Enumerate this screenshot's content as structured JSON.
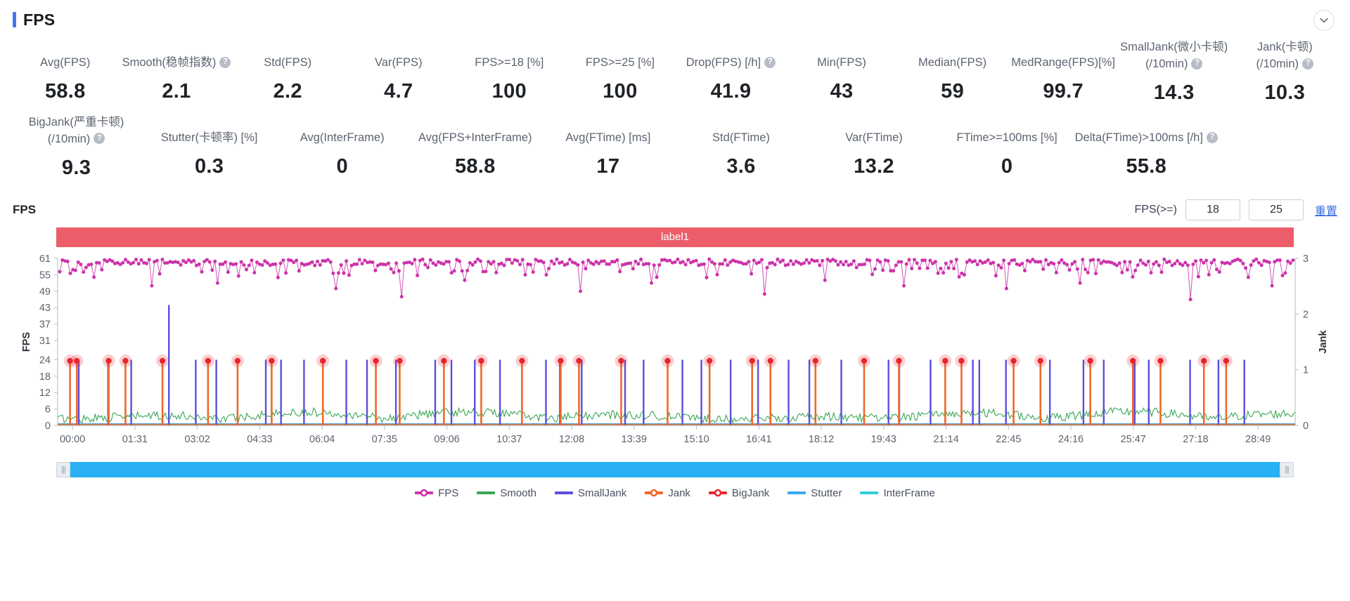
{
  "header": {
    "title": "FPS",
    "accent_color": "#4277f0",
    "collapse_icon": "chevron-down-icon"
  },
  "metrics_row1": [
    {
      "label_lines": [
        "Avg(FPS)"
      ],
      "help": false,
      "value": "58.8"
    },
    {
      "label_lines": [
        "Smooth(稳帧指数)"
      ],
      "help": true,
      "value": "2.1"
    },
    {
      "label_lines": [
        "Std(FPS)"
      ],
      "help": false,
      "value": "2.2"
    },
    {
      "label_lines": [
        "Var(FPS)"
      ],
      "help": false,
      "value": "4.7"
    },
    {
      "label_lines": [
        "FPS>=18 [%]"
      ],
      "help": false,
      "value": "100"
    },
    {
      "label_lines": [
        "FPS>=25 [%]"
      ],
      "help": false,
      "value": "100"
    },
    {
      "label_lines": [
        "Drop(FPS) [/h]"
      ],
      "help": true,
      "value": "41.9"
    },
    {
      "label_lines": [
        "Min(FPS)"
      ],
      "help": false,
      "value": "43"
    },
    {
      "label_lines": [
        "Median(FPS)"
      ],
      "help": false,
      "value": "59"
    },
    {
      "label_lines": [
        "MedRange(FPS)[%]"
      ],
      "help": false,
      "value": "99.7"
    },
    {
      "label_lines": [
        "SmallJank(微小卡顿)",
        "(/10min)"
      ],
      "help": true,
      "value": "14.3"
    },
    {
      "label_lines": [
        "Jank(卡顿)",
        "(/10min)"
      ],
      "help": true,
      "value": "10.3"
    }
  ],
  "metrics_row2": [
    {
      "label_lines": [
        "BigJank(严重卡顿)",
        "(/10min)"
      ],
      "help": true,
      "value": "9.3"
    },
    {
      "label_lines": [
        "Stutter(卡顿率) [%]"
      ],
      "help": false,
      "value": "0.3"
    },
    {
      "label_lines": [
        "Avg(InterFrame)"
      ],
      "help": false,
      "value": "0"
    },
    {
      "label_lines": [
        "Avg(FPS+InterFrame)"
      ],
      "help": false,
      "value": "58.8"
    },
    {
      "label_lines": [
        "Avg(FTime) [ms]"
      ],
      "help": false,
      "value": "17"
    },
    {
      "label_lines": [
        "Std(FTime)"
      ],
      "help": false,
      "value": "3.6"
    },
    {
      "label_lines": [
        "Var(FTime)"
      ],
      "help": false,
      "value": "13.2"
    },
    {
      "label_lines": [
        "FTime>=100ms [%]"
      ],
      "help": false,
      "value": "0"
    },
    {
      "label_lines": [
        "Delta(FTime)>100ms [/h]"
      ],
      "help": true,
      "value": "55.8"
    }
  ],
  "chart_header": {
    "title": "FPS",
    "threshold_label": "FPS(>=)",
    "threshold_1": "18",
    "threshold_2": "25",
    "reset_label": "重置"
  },
  "label_band": {
    "text": "label1",
    "color": "#ec5d6a"
  },
  "range_bar": {
    "left_handle": "|||",
    "right_handle": "|||",
    "color": "#29b0f4"
  },
  "chart_data": {
    "type": "line",
    "title": "FPS",
    "xlabel": "",
    "ylabel": "FPS",
    "y2label": "Jank",
    "grid": false,
    "legend_position": "bottom",
    "x_ticks": [
      "00:00",
      "01:31",
      "03:02",
      "04:33",
      "06:04",
      "07:35",
      "09:06",
      "10:37",
      "12:08",
      "13:39",
      "15:10",
      "16:41",
      "18:12",
      "19:43",
      "21:14",
      "22:45",
      "24:16",
      "25:47",
      "27:18",
      "28:49"
    ],
    "y_ticks": [
      0,
      6,
      12,
      18,
      24,
      31,
      37,
      43,
      49,
      55,
      61
    ],
    "ylim": [
      0,
      61
    ],
    "y2_ticks": [
      0,
      1,
      2,
      3
    ],
    "y2lim": [
      0,
      3
    ],
    "series": [
      {
        "name": "FPS",
        "color": "#cc33aa",
        "axis": "left",
        "style": "line-markers",
        "typical_value": 59,
        "min_value": 43,
        "dips": [
          56,
          51,
          52,
          54,
          50,
          47,
          53,
          55,
          49,
          52,
          54,
          48,
          53,
          51,
          55,
          50,
          52,
          54,
          46,
          51
        ]
      },
      {
        "name": "Smooth",
        "color": "#3aa655",
        "axis": "left",
        "style": "line",
        "typical_value": 3,
        "max_value": 8
      },
      {
        "name": "SmallJank",
        "color": "#5b4ee0",
        "axis": "right",
        "style": "impulse",
        "peak_value": 1,
        "count": 34
      },
      {
        "name": "Jank",
        "color": "#f0682a",
        "axis": "right",
        "style": "impulse-marker",
        "peak_value": 1,
        "count": 31
      },
      {
        "name": "BigJank",
        "color": "#e8262f",
        "axis": "right",
        "style": "marker",
        "peak_value": 1,
        "count": 31
      },
      {
        "name": "Stutter",
        "color": "#3ba7ee",
        "axis": "right",
        "style": "line",
        "typical_value": 0
      },
      {
        "name": "InterFrame",
        "color": "#2fd0d8",
        "axis": "right",
        "style": "line",
        "typical_value": 0
      }
    ]
  },
  "legend": [
    {
      "label": "FPS",
      "color": "#cc33aa",
      "marker": "circle"
    },
    {
      "label": "Smooth",
      "color": "#3aa655",
      "marker": "bar"
    },
    {
      "label": "SmallJank",
      "color": "#5b4ee0",
      "marker": "bar"
    },
    {
      "label": "Jank",
      "color": "#f0682a",
      "marker": "circle"
    },
    {
      "label": "BigJank",
      "color": "#e8262f",
      "marker": "circle"
    },
    {
      "label": "Stutter",
      "color": "#3ba7ee",
      "marker": "bar"
    },
    {
      "label": "InterFrame",
      "color": "#2fd0d8",
      "marker": "bar"
    }
  ]
}
